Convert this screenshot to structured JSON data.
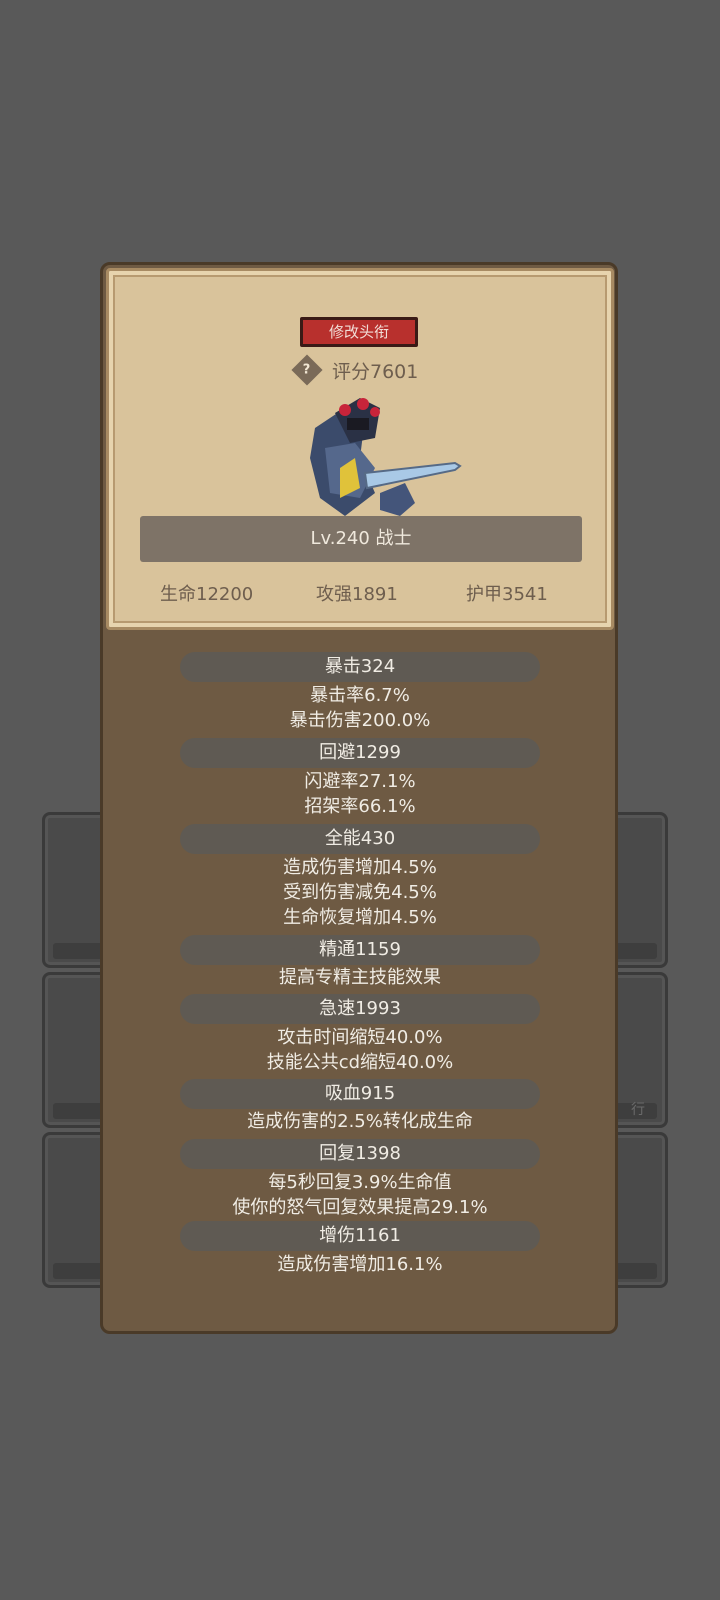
{
  "title_button": "修改头衔",
  "score": "评分7601",
  "help_icon": "?",
  "level_class": "Lv.240 战士",
  "card_stats": [
    "生命12200",
    "攻强1891",
    "护甲3541"
  ],
  "background_slot_text": "行",
  "stats": {
    "crit": {
      "header": "暴击324",
      "lines": [
        "暴击率6.7%",
        "暴击伤害200.0%"
      ]
    },
    "dodge": {
      "header": "回避1299",
      "lines": [
        "闪避率27.1%",
        "招架率66.1%"
      ]
    },
    "versatility": {
      "header": "全能430",
      "lines": [
        "造成伤害增加4.5%",
        "受到伤害减免4.5%",
        "生命恢复增加4.5%"
      ]
    },
    "mastery": {
      "header": "精通1159",
      "lines": [
        "提高专精主技能效果"
      ]
    },
    "haste": {
      "header": "急速1993",
      "lines": [
        "攻击时间缩短40.0%",
        "技能公共cd缩短40.0%"
      ]
    },
    "leech": {
      "header": "吸血915",
      "lines": [
        "造成伤害的2.5%转化成生命"
      ]
    },
    "regen": {
      "header": "回复1398",
      "lines": [
        "每5秒回复3.9%生命值",
        "使你的怒气回复效果提高29.1%"
      ]
    },
    "damage": {
      "header": "增伤1161",
      "lines": [
        "造成伤害增加16.1%"
      ]
    }
  }
}
